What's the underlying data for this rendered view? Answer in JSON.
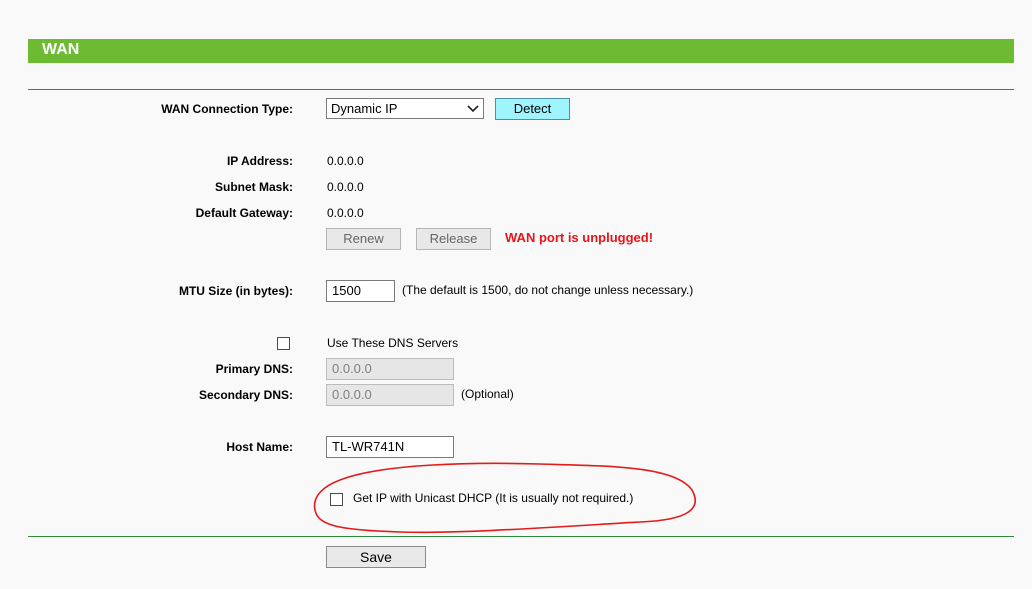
{
  "header": {
    "title": "WAN"
  },
  "connection": {
    "type_label": "WAN Connection Type:",
    "type_value": "Dynamic IP",
    "detect_label": "Detect"
  },
  "status": {
    "ip_label": "IP Address:",
    "ip_value": "0.0.0.0",
    "mask_label": "Subnet Mask:",
    "mask_value": "0.0.0.0",
    "gateway_label": "Default Gateway:",
    "gateway_value": "0.0.0.0",
    "renew_label": "Renew",
    "release_label": "Release",
    "warning": "WAN port is unplugged!",
    "warning_color": "#e8141a"
  },
  "mtu": {
    "label": "MTU Size (in bytes):",
    "value": "1500",
    "hint": "(The default is 1500, do not change unless necessary.)"
  },
  "dns": {
    "use_label": "Use These DNS Servers",
    "use_checked": false,
    "primary_label": "Primary DNS:",
    "primary_value": "0.0.0.0",
    "secondary_label": "Secondary DNS:",
    "secondary_value": "0.0.0.0",
    "optional_hint": "(Optional)"
  },
  "host": {
    "label": "Host Name:",
    "value": "TL-WR741N"
  },
  "unicast": {
    "label": "Get IP with Unicast DHCP (It is usually not required.)",
    "checked": false,
    "annotation_color": "#e31b1b"
  },
  "footer": {
    "save_label": "Save"
  },
  "colors": {
    "header_green": "#6dbb33",
    "divider_green": "#2f8a3f",
    "detect_bg": "#9ef4ff"
  }
}
